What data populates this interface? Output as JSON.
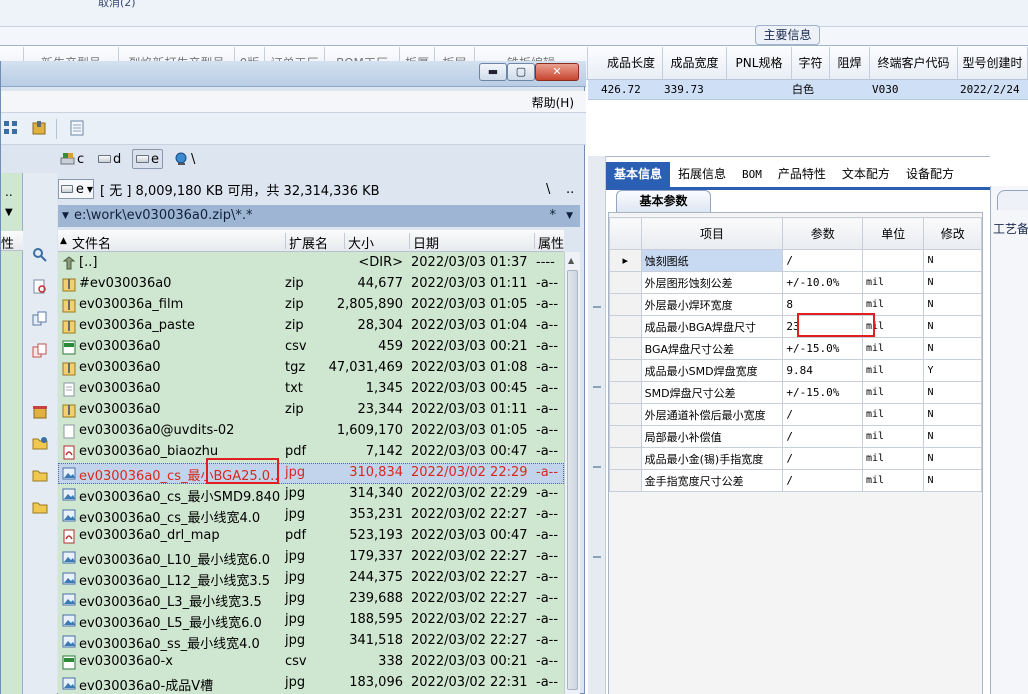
{
  "background_app": {
    "cancel_text": "取消(2)",
    "main_info_tab": "主要信息",
    "grid_header_hidden": [
      "新生产型号",
      "烈焰新打生产型号",
      "0版",
      "订单工厂",
      "BOM工厂",
      "板厚",
      "板层",
      "铣板编辑"
    ],
    "grid_header": [
      "成品长度",
      "成品宽度",
      "PNL规格",
      "字符",
      "阻焊",
      "终端客户代码",
      "型号创建时"
    ],
    "grid_row": {
      "length": "426.72",
      "width": "339.73",
      "char": "白色",
      "customer_code": "V030",
      "create_date": "2022/2/24"
    },
    "detail_tabs": [
      "基本信息",
      "拓展信息",
      "BOM",
      "产品特性",
      "文本配方",
      "设备配方"
    ],
    "subtab": "基本参数",
    "param_columns": [
      "项目",
      "参数",
      "单位",
      "修改"
    ],
    "param_rows": [
      {
        "item": "蚀刻图纸",
        "value": "/",
        "unit": "",
        "mod": "N"
      },
      {
        "item": "外层图形蚀刻公差",
        "value": "+/-10.0%",
        "unit": "mil",
        "mod": "N"
      },
      {
        "item": "外层最小焊环宽度",
        "value": "8",
        "unit": "mil",
        "mod": "N"
      },
      {
        "item": "成品最小BGA焊盘尺寸",
        "value": "23",
        "unit": "mil",
        "mod": "N"
      },
      {
        "item": "BGA焊盘尺寸公差",
        "value": "+/-15.0%",
        "unit": "mil",
        "mod": "N"
      },
      {
        "item": "成品最小SMD焊盘宽度",
        "value": "9.84",
        "unit": "mil",
        "mod": "Y"
      },
      {
        "item": "SMD焊盘尺寸公差",
        "value": "+/-15.0%",
        "unit": "mil",
        "mod": "N"
      },
      {
        "item": "外层通道补偿后最小宽度",
        "value": "/",
        "unit": "mil",
        "mod": "N"
      },
      {
        "item": "局部最小补偿值",
        "value": "/",
        "unit": "mil",
        "mod": "N"
      },
      {
        "item": "成品最小金(锡)手指宽度",
        "value": "/",
        "unit": "mil",
        "mod": "N"
      },
      {
        "item": "金手指宽度尺寸公差",
        "value": "/",
        "unit": "mil",
        "mod": "N"
      }
    ],
    "far_right_label": "工艺备"
  },
  "file_manager": {
    "menu_help": "帮助(H)",
    "drives": [
      "c",
      "d",
      "e",
      "\\"
    ],
    "active_drive": "e",
    "free_space": "[ 无 ]  8,009,180 KB 可用，共 32,314,336 KB",
    "nav_backslash": "\\",
    "nav_dots": "..",
    "current_path": "e:\\work\\ev030036a0.zip\\*.*",
    "filter_star": "*",
    "left_pane_dots": "..",
    "left_pane_header": "性",
    "columns": {
      "name": "文件名",
      "ext": "扩展名",
      "size": "大小",
      "date": "日期",
      "attr": "属性"
    },
    "files": [
      {
        "name": "[..]",
        "ext": "",
        "size": "<DIR>",
        "date": "2022/03/03 01:37",
        "attr": "----",
        "icon": "up-dir-icon"
      },
      {
        "name": "#ev030036a0",
        "ext": "zip",
        "size": "44,677",
        "date": "2022/03/03 01:11",
        "attr": "-a--",
        "icon": "zip-icon"
      },
      {
        "name": "ev030036a_film",
        "ext": "zip",
        "size": "2,805,890",
        "date": "2022/03/03 01:05",
        "attr": "-a--",
        "icon": "zip-icon"
      },
      {
        "name": "ev030036a_paste",
        "ext": "zip",
        "size": "28,304",
        "date": "2022/03/03 01:04",
        "attr": "-a--",
        "icon": "zip-icon"
      },
      {
        "name": "ev030036a0",
        "ext": "csv",
        "size": "459",
        "date": "2022/03/03 00:21",
        "attr": "-a--",
        "icon": "csv-icon"
      },
      {
        "name": "ev030036a0",
        "ext": "tgz",
        "size": "47,031,469",
        "date": "2022/03/03 01:08",
        "attr": "-a--",
        "icon": "zip-icon"
      },
      {
        "name": "ev030036a0",
        "ext": "txt",
        "size": "1,345",
        "date": "2022/03/03 00:45",
        "attr": "-a--",
        "icon": "text-file-icon"
      },
      {
        "name": "ev030036a0",
        "ext": "zip",
        "size": "23,344",
        "date": "2022/03/03 01:11",
        "attr": "-a--",
        "icon": "zip-icon"
      },
      {
        "name": "ev030036a0@uvdits-02",
        "ext": "",
        "size": "1,609,170",
        "date": "2022/03/03 01:05",
        "attr": "-a--",
        "icon": "blank-file-icon"
      },
      {
        "name": "ev030036a0_biaozhu",
        "ext": "pdf",
        "size": "7,142",
        "date": "2022/03/03 00:47",
        "attr": "-a--",
        "icon": "pdf-icon"
      },
      {
        "name": "ev030036a0_cs_最小BGA25.0..",
        "ext": "jpg",
        "size": "310,834",
        "date": "2022/03/02 22:29",
        "attr": "-a--",
        "icon": "image-icon",
        "selected": true
      },
      {
        "name": "ev030036a0_cs_最小SMD9.840",
        "ext": "jpg",
        "size": "314,340",
        "date": "2022/03/02 22:29",
        "attr": "-a--",
        "icon": "image-icon"
      },
      {
        "name": "ev030036a0_cs_最小线宽4.0",
        "ext": "jpg",
        "size": "353,231",
        "date": "2022/03/02 22:27",
        "attr": "-a--",
        "icon": "image-icon"
      },
      {
        "name": "ev030036a0_drl_map",
        "ext": "pdf",
        "size": "523,193",
        "date": "2022/03/03 00:47",
        "attr": "-a--",
        "icon": "pdf-icon"
      },
      {
        "name": "ev030036a0_L10_最小线宽6.0",
        "ext": "jpg",
        "size": "179,337",
        "date": "2022/03/02 22:27",
        "attr": "-a--",
        "icon": "image-icon"
      },
      {
        "name": "ev030036a0_L12_最小线宽3.5",
        "ext": "jpg",
        "size": "244,375",
        "date": "2022/03/02 22:27",
        "attr": "-a--",
        "icon": "image-icon"
      },
      {
        "name": "ev030036a0_L3_最小线宽3.5",
        "ext": "jpg",
        "size": "239,688",
        "date": "2022/03/02 22:27",
        "attr": "-a--",
        "icon": "image-icon"
      },
      {
        "name": "ev030036a0_L5_最小线宽6.0",
        "ext": "jpg",
        "size": "188,595",
        "date": "2022/03/02 22:27",
        "attr": "-a--",
        "icon": "image-icon"
      },
      {
        "name": "ev030036a0_ss_最小线宽4.0",
        "ext": "jpg",
        "size": "341,518",
        "date": "2022/03/02 22:27",
        "attr": "-a--",
        "icon": "image-icon"
      },
      {
        "name": "ev030036a0-x",
        "ext": "csv",
        "size": "338",
        "date": "2022/03/03 00:21",
        "attr": "-a--",
        "icon": "csv-icon"
      },
      {
        "name": "ev030036a0-成品V槽",
        "ext": "jpg",
        "size": "183,096",
        "date": "2022/03/02 22:31",
        "attr": "-a--",
        "icon": "image-icon"
      }
    ]
  },
  "colors": {
    "file_list_bg": "#cfe6d0",
    "selected_text": "#d8281e",
    "highlight_box": "#e02020",
    "active_tab": "#2b5fb3"
  }
}
